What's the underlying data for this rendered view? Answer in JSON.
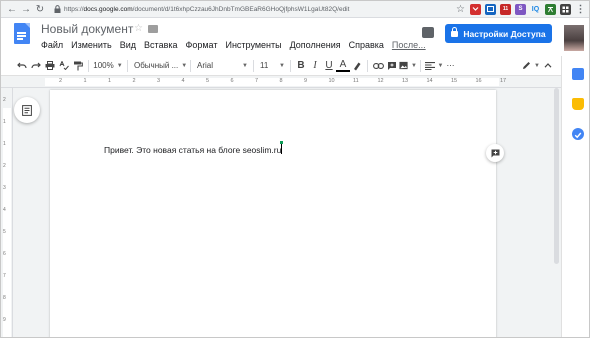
{
  "browser": {
    "url_prefix": "https://",
    "url_host": "docs.google.com",
    "url_path": "/document/d/1t6xhpCzzau6JhDnbTmGBEaR6GHoQjfphsW1LgaUt82Q/edit",
    "extensions": [
      {
        "name": "star-icon",
        "color": "#5f6368"
      },
      {
        "name": "pocket-icon",
        "color": "#d32f2f"
      },
      {
        "name": "image-ext-icon",
        "color": "#1565c0"
      },
      {
        "name": "calendar-ext-icon",
        "color": "#c62828",
        "badge": "11"
      },
      {
        "name": "ext-s-icon",
        "color": "#7e57c2",
        "label": "S"
      },
      {
        "name": "ext-iq-icon",
        "color": "#1e88e5",
        "label": "IQ"
      },
      {
        "name": "translate-icon",
        "color": "#2e7d32"
      },
      {
        "name": "ext-grid-icon",
        "color": "#424242"
      },
      {
        "name": "menu-dots-icon",
        "color": "#5f6368",
        "label": "⋮"
      }
    ]
  },
  "doc": {
    "title": "Новый документ",
    "menus": [
      "Файл",
      "Изменить",
      "Вид",
      "Вставка",
      "Формат",
      "Инструменты",
      "Дополнения",
      "Справка"
    ],
    "last_edit": "После...",
    "share_label": "Настройки Доступа"
  },
  "toolbar": {
    "zoom": "100%",
    "style": "Обычный ...",
    "font": "Arial",
    "size": "11"
  },
  "ruler": {
    "numbers": [
      "2",
      "1",
      "1",
      "2",
      "3",
      "4",
      "5",
      "6",
      "7",
      "8",
      "9",
      "10",
      "11",
      "12",
      "13",
      "14",
      "15",
      "16",
      "17"
    ]
  },
  "vruler": {
    "numbers": [
      "2",
      "1",
      "1",
      "2",
      "3",
      "4",
      "5",
      "6",
      "7",
      "8",
      "9",
      "10"
    ]
  },
  "document": {
    "body_text": "Привет. Это новая статья на блоге seoslim.ru"
  },
  "side_panel": [
    {
      "name": "calendar-icon",
      "color": "#4285f4"
    },
    {
      "name": "keep-icon",
      "color": "#fbbc04"
    },
    {
      "name": "tasks-icon",
      "color": "#4285f4"
    }
  ]
}
